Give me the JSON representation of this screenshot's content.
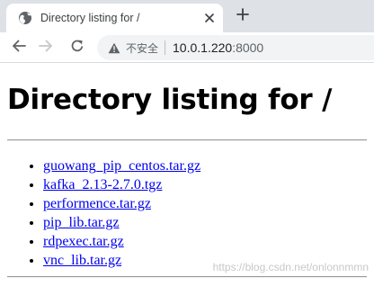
{
  "browser": {
    "tab": {
      "title": "Directory listing for /",
      "favicon": "globe-icon"
    },
    "toolbar": {
      "security_label": "不安全",
      "url_host": "10.0.1.220",
      "url_port": ":8000"
    }
  },
  "page": {
    "title": "Directory listing for /",
    "files": [
      "guowang_pip_centos.tar.gz",
      "kafka_2.13-2.7.0.tgz",
      "performence.tar.gz",
      "pip_lib.tar.gz",
      "rdpexec.tar.gz",
      "vnc_lib.tar.gz"
    ]
  },
  "watermark": "https://blog.csdn.net/onlonnmmn",
  "colors": {
    "link": "#0000ee",
    "tabstrip": "#dee1e6",
    "omnibox": "#f1f3f4"
  }
}
